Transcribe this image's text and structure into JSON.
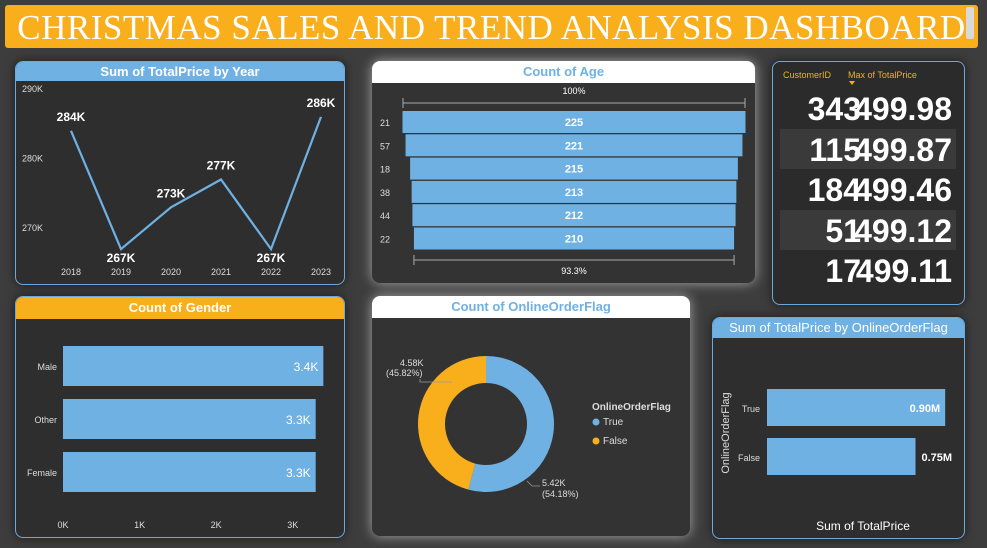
{
  "dashboard": {
    "title": "CHRISTMAS SALES AND TREND ANALYSIS DASHBOARD"
  },
  "colors": {
    "title_bg": "#f9ae1c",
    "accent_blue": "#6fb1e3",
    "accent_orange": "#f9ae1c",
    "background": "#3d3d3d"
  },
  "year_panel": {
    "title": "Sum of TotalPrice by Year"
  },
  "age_panel": {
    "title": "Count of Age",
    "top_label": "100%",
    "bottom_label": "93.3%"
  },
  "gender_panel": {
    "title": "Count of Gender"
  },
  "online_panel": {
    "title": "Count of OnlineOrderFlag",
    "legend_title": "OnlineOrderFlag",
    "labels": {
      "false": [
        "4.58K",
        "(45.82%)"
      ],
      "true": [
        "5.42K",
        "(54.18%)"
      ]
    }
  },
  "sum_online_panel": {
    "title": "Sum of TotalPrice by OnlineOrderFlag",
    "ylabel": "OnlineOrderFlag",
    "xlabel": "Sum of TotalPrice"
  },
  "table": {
    "headers": [
      "CustomerID",
      "Max of TotalPrice"
    ],
    "rows": [
      {
        "id": "343",
        "value": "499.98"
      },
      {
        "id": "115",
        "value": "499.87"
      },
      {
        "id": "184",
        "value": "499.46"
      },
      {
        "id": "51",
        "value": "499.12"
      },
      {
        "id": "17",
        "value": "499.11"
      }
    ]
  },
  "chart_data": [
    {
      "type": "line",
      "title": "Sum of TotalPrice by Year",
      "x": [
        "2018",
        "2019",
        "2020",
        "2021",
        "2022",
        "2023"
      ],
      "values": [
        284,
        267,
        273,
        277,
        267,
        286
      ],
      "labels": [
        "284K",
        "267K",
        "273K",
        "277K",
        "267K",
        "286K"
      ],
      "yticks": [
        "270K",
        "280K",
        "290K"
      ],
      "ylim": [
        265,
        290
      ],
      "color": "#6fb1e3"
    },
    {
      "type": "bar",
      "orientation": "funnel",
      "title": "Count of Age",
      "categories": [
        "21",
        "57",
        "18",
        "38",
        "44",
        "22"
      ],
      "values": [
        225,
        221,
        215,
        213,
        212,
        210
      ],
      "color": "#6fb1e3"
    },
    {
      "type": "bar",
      "orientation": "horizontal",
      "title": "Count of Gender",
      "categories": [
        "Male",
        "Other",
        "Female"
      ],
      "values": [
        3.4,
        3.3,
        3.3
      ],
      "labels": [
        "3.4K",
        "3.3K",
        "3.3K"
      ],
      "xticks": [
        "0K",
        "1K",
        "2K",
        "3K"
      ],
      "xlim": [
        0,
        3.5
      ],
      "color": "#6fb1e3"
    },
    {
      "type": "pie",
      "subtype": "donut",
      "title": "Count of OnlineOrderFlag",
      "series": [
        {
          "name": "True",
          "value": 5.42,
          "percent": 54.18,
          "color": "#6fb1e3"
        },
        {
          "name": "False",
          "value": 4.58,
          "percent": 45.82,
          "color": "#f9ae1c"
        }
      ]
    },
    {
      "type": "bar",
      "orientation": "horizontal",
      "title": "Sum of TotalPrice by OnlineOrderFlag",
      "categories": [
        "True",
        "False"
      ],
      "values": [
        0.9,
        0.75
      ],
      "labels": [
        "0.90M",
        "0.75M"
      ],
      "xlabel": "Sum of TotalPrice",
      "ylabel": "OnlineOrderFlag",
      "xlim": [
        0,
        1.0
      ],
      "color": "#6fb1e3"
    }
  ]
}
